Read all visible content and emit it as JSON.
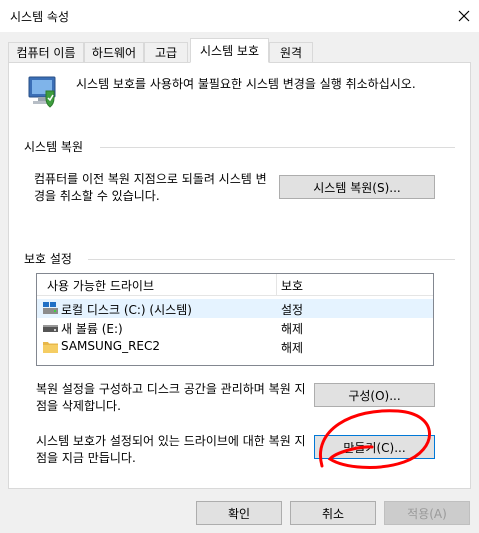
{
  "window": {
    "title": "시스템 속성"
  },
  "tabs": [
    {
      "label": "컴퓨터 이름"
    },
    {
      "label": "하드웨어"
    },
    {
      "label": "고급"
    },
    {
      "label": "시스템 보호"
    },
    {
      "label": "원격"
    }
  ],
  "intro": {
    "text": "시스템 보호를 사용하여 불필요한 시스템 변경을 실행 취소하십시오."
  },
  "restore": {
    "group_label": "시스템 복원",
    "description": "컴퓨터를 이전 복원 지점으로 되돌려 시스템 변경을 취소할 수 있습니다.",
    "button_label": "시스템 복원(S)..."
  },
  "protection": {
    "group_label": "보호 설정",
    "columns": [
      "사용 가능한 드라이브",
      "보호"
    ],
    "drives": [
      {
        "name": "로컬 디스크 (C:) (시스템)",
        "status": "설정",
        "icon": "system-drive-icon"
      },
      {
        "name": "새 볼륨 (E:)",
        "status": "해제",
        "icon": "drive-icon"
      },
      {
        "name": "SAMSUNG_REC2",
        "status": "해제",
        "icon": "folder-icon"
      }
    ],
    "configure_desc": "복원 설정을 구성하고 디스크 공간을 관리하며 복원 지점을 삭제합니다.",
    "configure_button": "구성(O)...",
    "create_desc": "시스템 보호가 설정되어 있는 드라이브에 대한 복원 지점을 지금 만듭니다.",
    "create_button": "만들기(C)..."
  },
  "footer": {
    "ok": "확인",
    "cancel": "취소",
    "apply": "적용(A)"
  },
  "colors": {
    "annotation": "#ff0000",
    "selection": "#e5f3ff",
    "focus": "#0078d7"
  }
}
